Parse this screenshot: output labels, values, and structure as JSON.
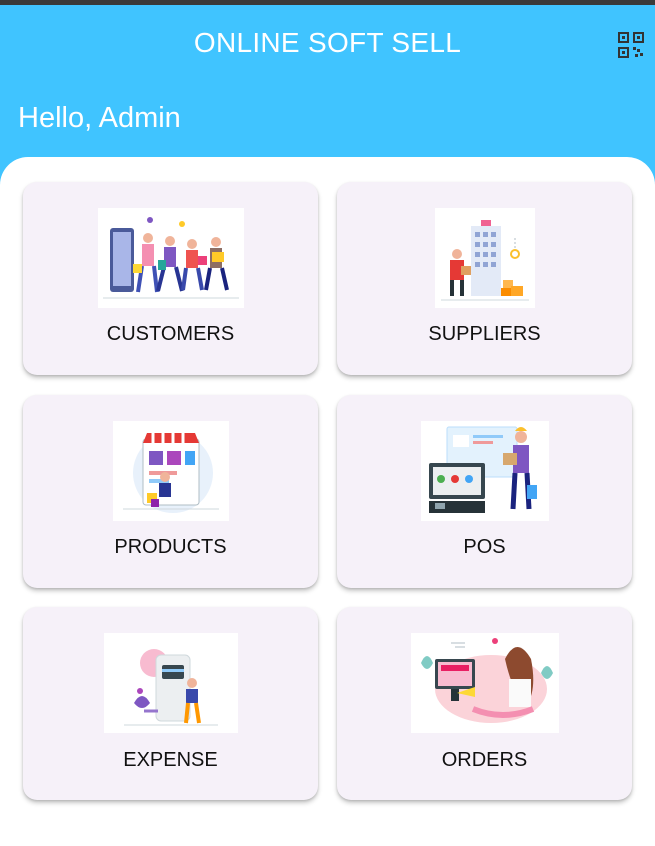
{
  "app": {
    "title": "ONLINE SOFT SELL",
    "greeting": "Hello, Admin",
    "qr_icon": "qr-code-scan-icon",
    "accent_color": "#40c4ff",
    "card_color": "#f6f1f9"
  },
  "menu": [
    {
      "label": "CUSTOMERS",
      "illustration": "customers-illustration"
    },
    {
      "label": "SUPPLIERS",
      "illustration": "suppliers-illustration"
    },
    {
      "label": "PRODUCTS",
      "illustration": "products-illustration"
    },
    {
      "label": "POS",
      "illustration": "pos-illustration"
    },
    {
      "label": "EXPENSE",
      "illustration": "expense-illustration"
    },
    {
      "label": "ORDERS",
      "illustration": "orders-illustration"
    }
  ]
}
